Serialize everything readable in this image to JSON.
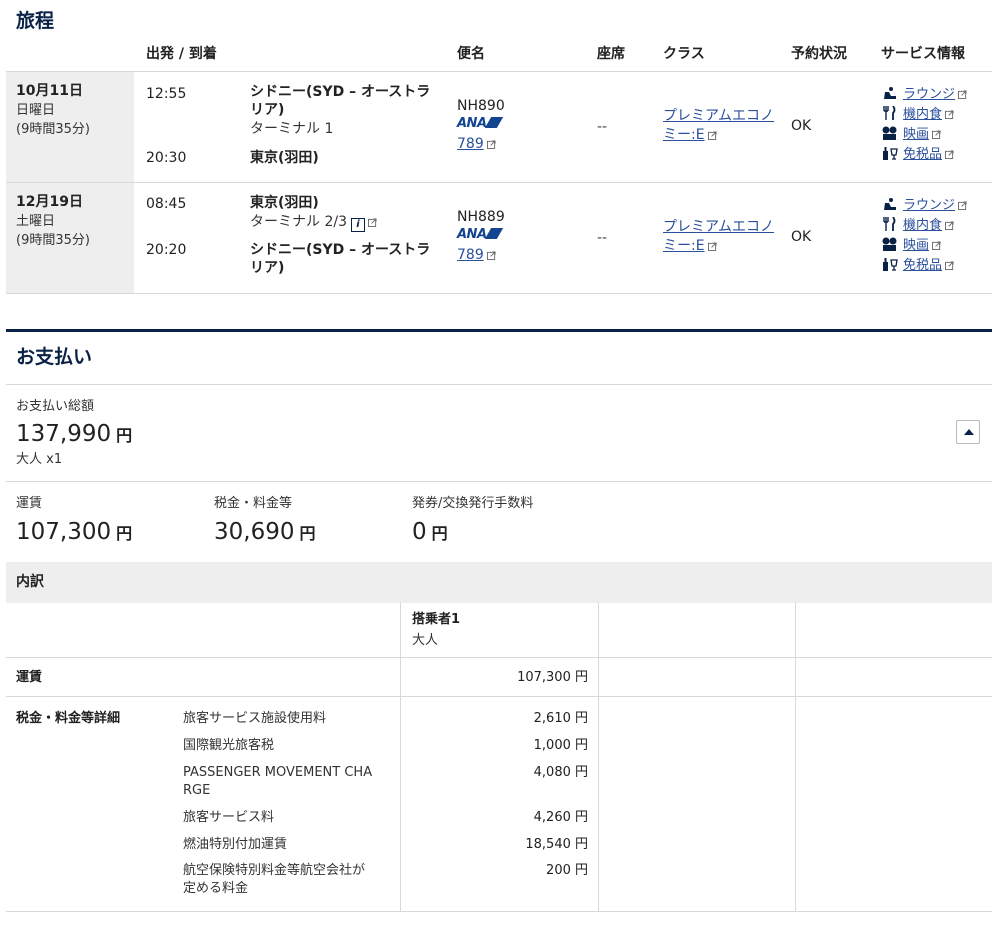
{
  "itinerary": {
    "title": "旅程",
    "headers": {
      "dep_arr": "出発 / 到着",
      "flight": "便名",
      "seat": "座席",
      "class": "クラス",
      "status": "予約状況",
      "service": "サービス情報"
    },
    "flights": [
      {
        "date": "10月11日",
        "weekday": "日曜日",
        "duration": "(9時間35分)",
        "dep_time": "12:55",
        "dep_place_line1": "シドニー(SYD – オーストラ",
        "dep_place_line2": "リア)",
        "dep_terminal": "ターミナル 1",
        "arr_time": "20:30",
        "arr_place_line1": "東京(羽田)",
        "arr_place_line2": "",
        "arr_terminal": "",
        "flight_no": "NH890",
        "airline_logo": "ANA",
        "aircraft": "789",
        "seat": "--",
        "class_line1": "プレミアムエコノ",
        "class_line2": "ミー:E",
        "status": "OK",
        "services": [
          "ラウンジ",
          "機内食",
          "映画",
          "免税品"
        ]
      },
      {
        "date": "12月19日",
        "weekday": "土曜日",
        "duration": "(9時間35分)",
        "dep_time": "08:45",
        "dep_place_line1": "東京(羽田)",
        "dep_place_line2": "",
        "dep_terminal": "ターミナル 2/3",
        "arr_time": "20:20",
        "arr_place_line1": "シドニー(SYD – オーストラ",
        "arr_place_line2": "リア)",
        "arr_terminal": "",
        "flight_no": "NH889",
        "airline_logo": "ANA",
        "aircraft": "789",
        "seat": "--",
        "class_line1": "プレミアムエコノ",
        "class_line2": "ミー:E",
        "status": "OK",
        "services": [
          "ラウンジ",
          "機内食",
          "映画",
          "免税品"
        ]
      }
    ]
  },
  "payment": {
    "title": "お支払い",
    "total_label": "お支払い総額",
    "total_amount": "137,990",
    "currency": "円",
    "pax_count": "大人 x1",
    "fare_label": "運賃",
    "fare_amount": "107,300",
    "tax_label": "税金・料金等",
    "tax_amount": "30,690",
    "fee_label": "発券/交換発行手数料",
    "fee_amount": "0"
  },
  "breakdown": {
    "title": "内訳",
    "passenger_header": "搭乗者1",
    "passenger_type": "大人",
    "fare_row_label": "運賃",
    "fare_row_amount": "107,300 円",
    "tax_section_label": "税金・料金等詳細",
    "tax_items": [
      {
        "name_line1": "旅客サービス施設使用料",
        "name_line2": "",
        "amount": "2,610 円"
      },
      {
        "name_line1": "国際観光旅客税",
        "name_line2": "",
        "amount": "1,000 円"
      },
      {
        "name_line1": "PASSENGER MOVEMENT CHA",
        "name_line2": "RGE",
        "amount": "4,080 円"
      },
      {
        "name_line1": "旅客サービス料",
        "name_line2": "",
        "amount": "4,260 円"
      },
      {
        "name_line1": "燃油特別付加運賃",
        "name_line2": "",
        "amount": "18,540 円"
      },
      {
        "name_line1": "航空保険特別料金等航空会社が",
        "name_line2": "定める料金",
        "amount": "200 円"
      }
    ]
  },
  "colors": {
    "navy": "#0a2146",
    "link": "#2a4f9c",
    "row_gray": "#eeeeee",
    "ana_blue": "#13448f"
  },
  "icons": [
    "lounge-icon",
    "meal-icon",
    "movie-icon",
    "dutyfree-icon",
    "external-link-icon",
    "info-icon",
    "collapse-toggle-icon"
  ]
}
